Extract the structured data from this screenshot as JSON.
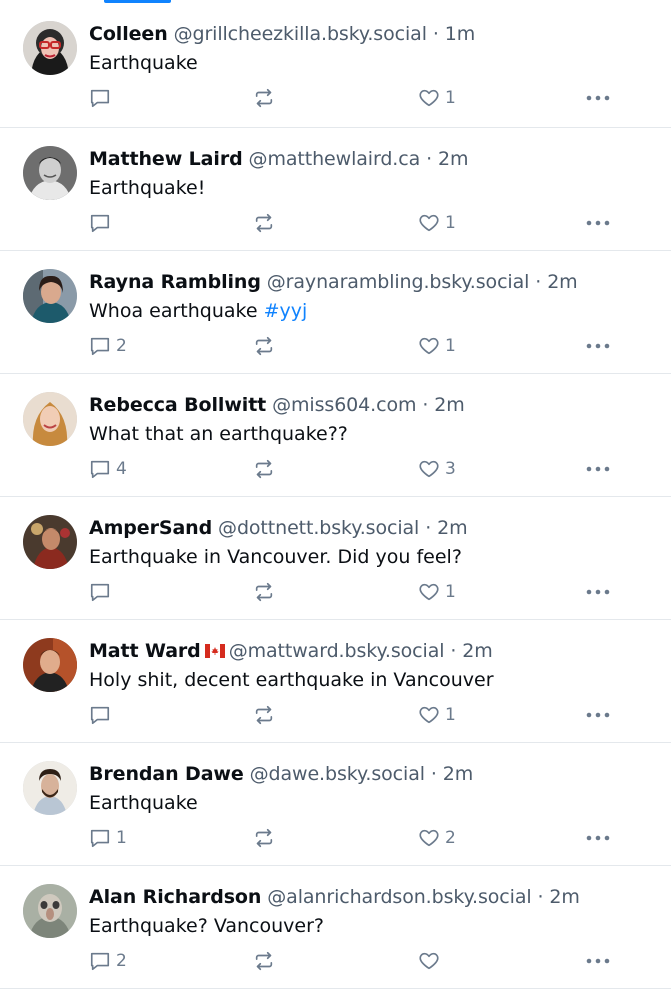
{
  "colors": {
    "accent": "#1083fe",
    "muted": "#4d5b6b",
    "text": "#0b0f14",
    "divider": "#e4e8ec"
  },
  "posts": [
    {
      "name": "Colleen",
      "handle": "@grillcheezkilla.bsky.social",
      "time": "1m",
      "text": "Earthquake",
      "hashtag": "",
      "replies": "",
      "reposts": "",
      "likes": "1",
      "avatar": "avatar-colleen"
    },
    {
      "name": "Matthew Laird",
      "handle": "@matthewlaird.ca",
      "time": "2m",
      "text": "Earthquake!",
      "hashtag": "",
      "replies": "",
      "reposts": "",
      "likes": "1",
      "avatar": "avatar-matthew"
    },
    {
      "name": "Rayna Rambling",
      "handle": "@raynarambling.bsky.social",
      "time": "2m",
      "text": "Whoa earthquake",
      "hashtag": "#yyj",
      "replies": "2",
      "reposts": "",
      "likes": "1",
      "avatar": "avatar-rayna"
    },
    {
      "name": "Rebecca Bollwitt",
      "handle": "@miss604.com",
      "time": "2m",
      "text": "What that an earthquake??",
      "hashtag": "",
      "replies": "4",
      "reposts": "",
      "likes": "3",
      "avatar": "avatar-rebecca"
    },
    {
      "name": "AmperSand",
      "handle": "@dottnett.bsky.social",
      "time": "2m",
      "text": "Earthquake in Vancouver. Did you feel?",
      "hashtag": "",
      "replies": "",
      "reposts": "",
      "likes": "1",
      "avatar": "avatar-ampersand"
    },
    {
      "name": "Matt Ward",
      "flag": "canada-flag",
      "handle": "@mattward.bsky.social",
      "time": "2m",
      "text": "Holy shit, decent earthquake in Vancouver",
      "hashtag": "",
      "replies": "",
      "reposts": "",
      "likes": "1",
      "avatar": "avatar-mattward"
    },
    {
      "name": "Brendan Dawe",
      "handle": "@dawe.bsky.social",
      "time": "2m",
      "text": "Earthquake",
      "hashtag": "",
      "replies": "1",
      "reposts": "",
      "likes": "2",
      "avatar": "avatar-brendan"
    },
    {
      "name": "Alan Richardson",
      "handle": "@alanrichardson.bsky.social",
      "time": "2m",
      "text": "Earthquake? Vancouver?",
      "hashtag": "",
      "replies": "2",
      "reposts": "",
      "likes": "",
      "avatar": "avatar-alan"
    }
  ],
  "separator": "·"
}
